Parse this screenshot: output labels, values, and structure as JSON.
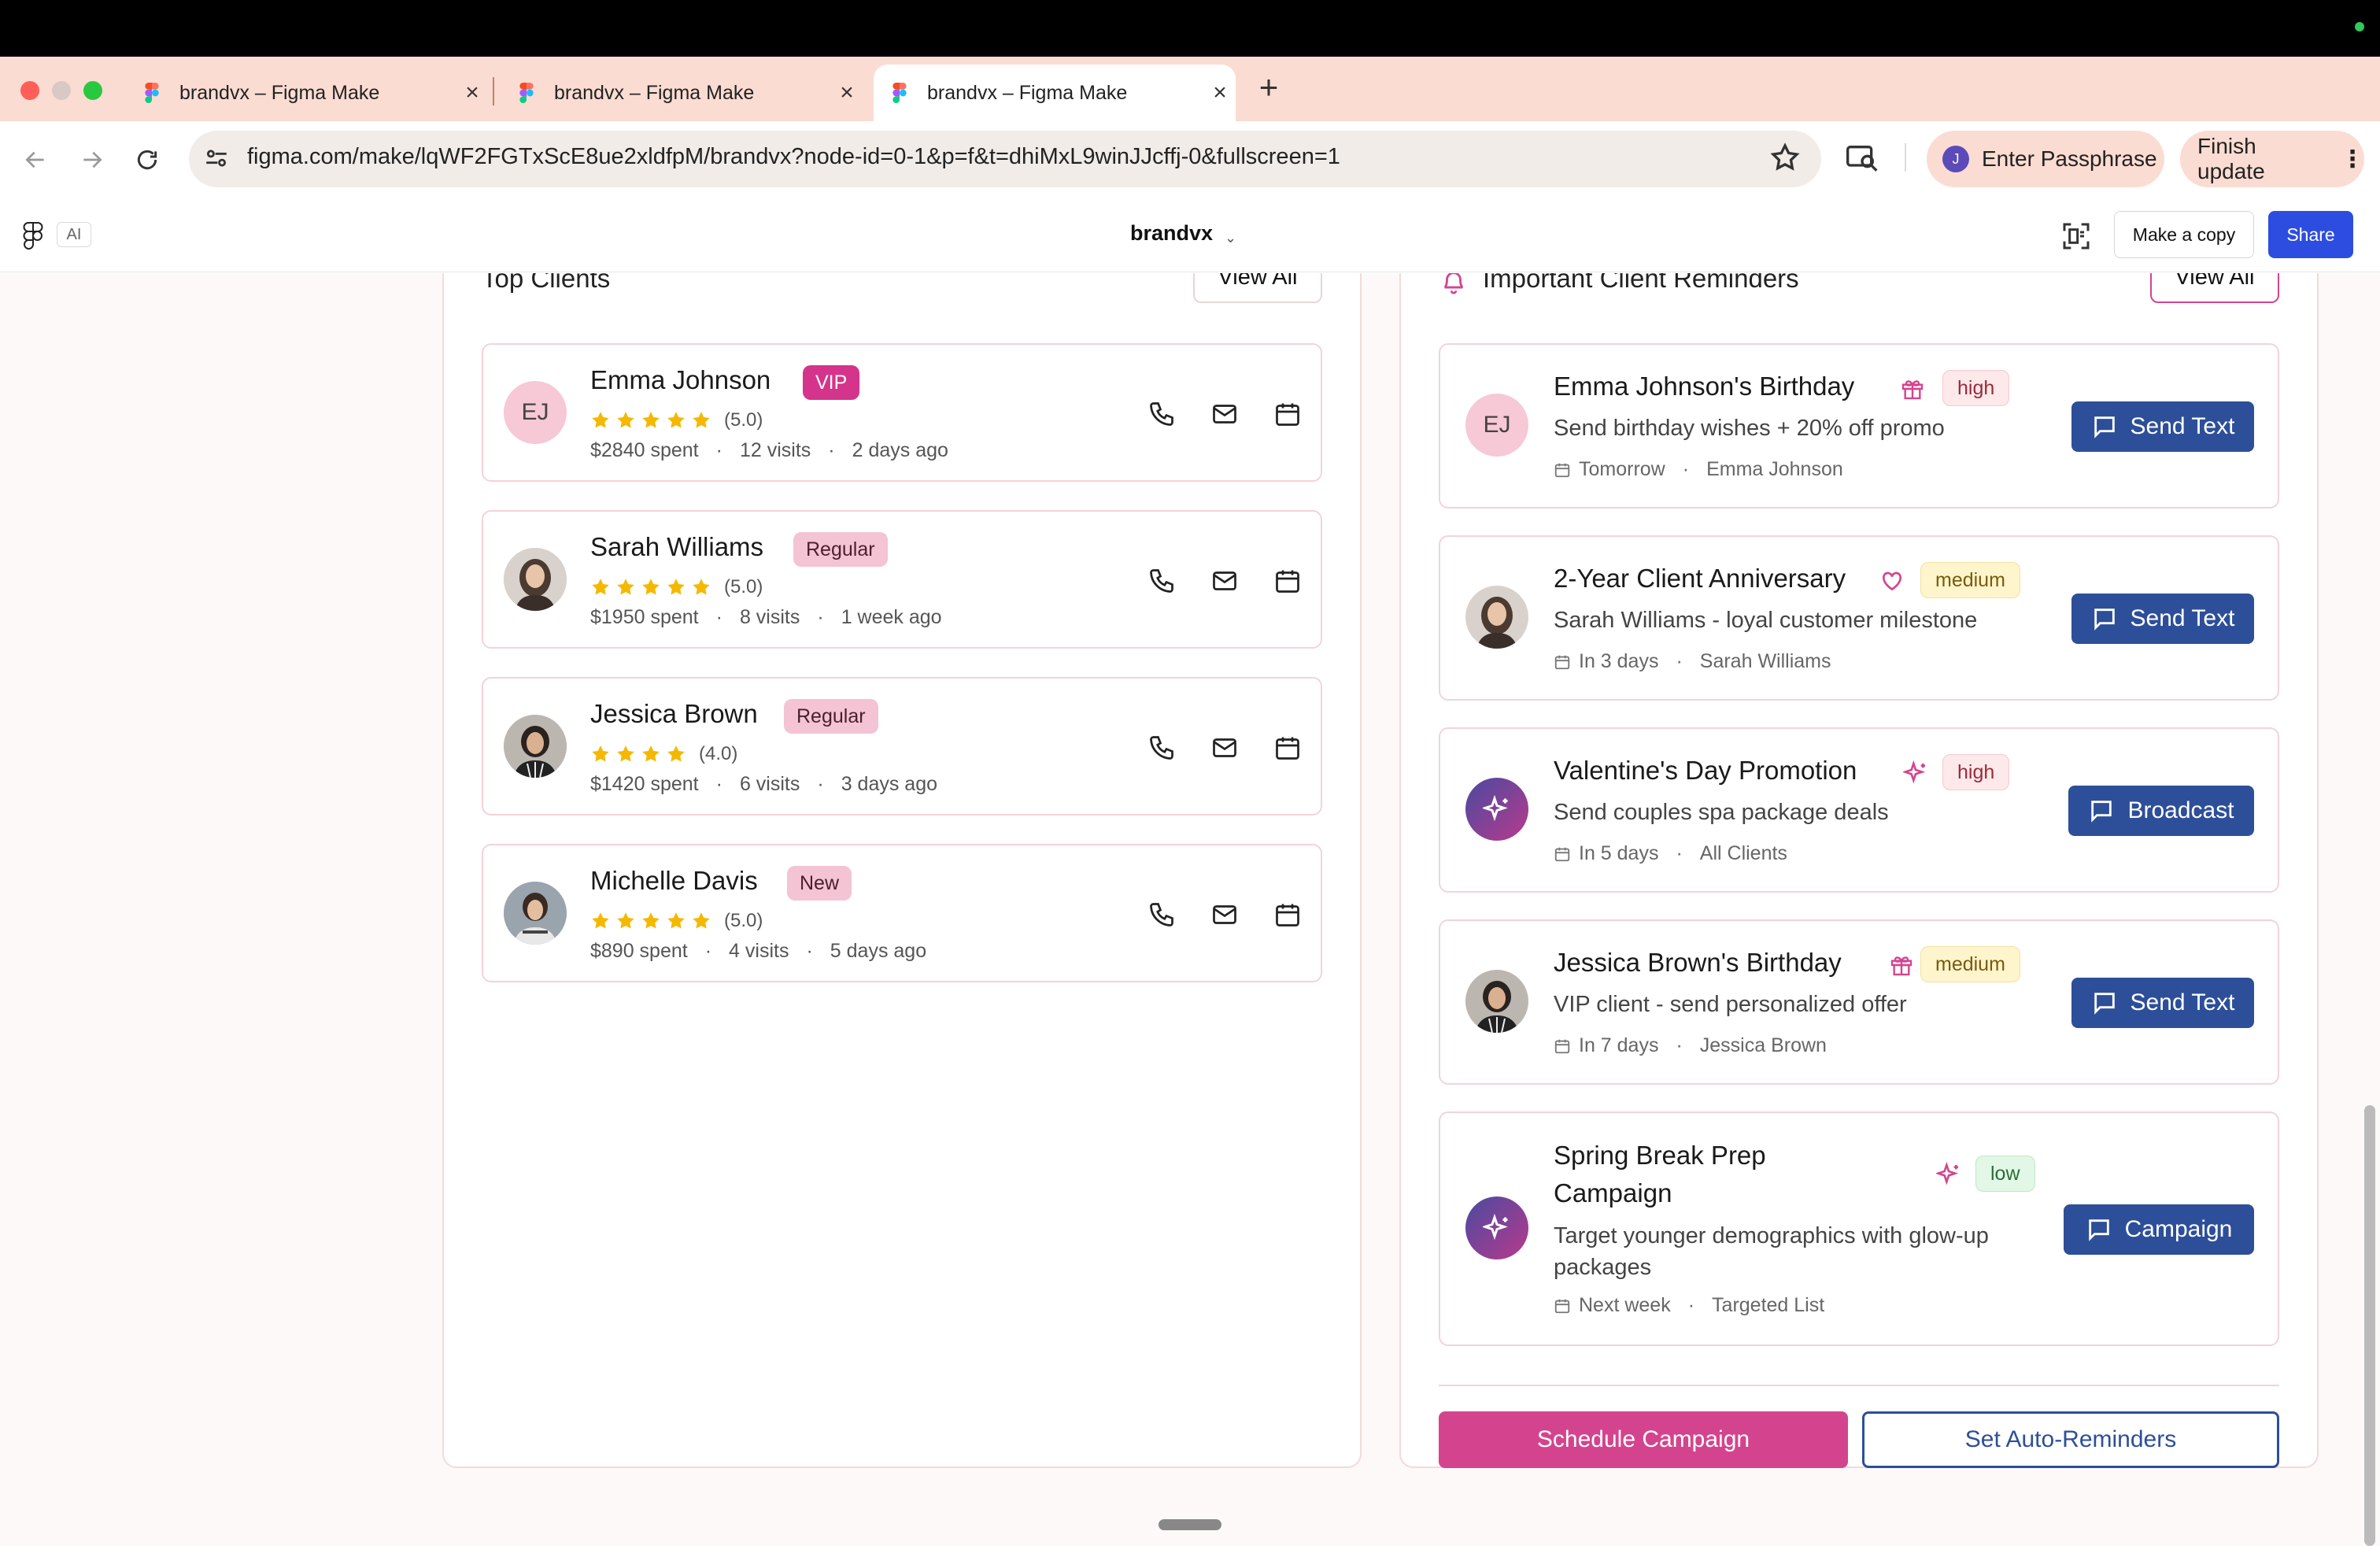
{
  "browser": {
    "tabs": [
      {
        "title": "brandvx – Figma Make",
        "active": false
      },
      {
        "title": "brandvx – Figma Make",
        "active": false
      },
      {
        "title": "brandvx – Figma Make",
        "active": true
      }
    ],
    "url": "figma.com/make/lqWF2FGTxScE8ue2xldfpM/brandvx?node-id=0-1&p=f&t=dhiMxL9winJJcffj-0&fullscreen=1",
    "passphrase_label": "Enter Passphrase",
    "passphrase_avatar": "J",
    "update_label": "Finish update"
  },
  "figma": {
    "ai_badge": "AI",
    "file_name": "brandvx",
    "make_copy_label": "Make a copy",
    "share_label": "Share"
  },
  "top_clients": {
    "title": "Top Clients",
    "view_all": "View All",
    "clients": [
      {
        "name": "Emma Johnson",
        "badge": "VIP",
        "badge_type": "vip",
        "initials": "EJ",
        "stars": 5,
        "rating": "(5.0)",
        "spent": "$2840 spent",
        "visits": "12 visits",
        "last": "2 days ago"
      },
      {
        "name": "Sarah Williams",
        "badge": "Regular",
        "badge_type": "regular",
        "initials": "",
        "stars": 5,
        "rating": "(5.0)",
        "spent": "$1950 spent",
        "visits": "8 visits",
        "last": "1 week ago"
      },
      {
        "name": "Jessica Brown",
        "badge": "Regular",
        "badge_type": "regular",
        "initials": "",
        "stars": 4,
        "rating": "(4.0)",
        "spent": "$1420 spent",
        "visits": "6 visits",
        "last": "3 days ago"
      },
      {
        "name": "Michelle Davis",
        "badge": "New",
        "badge_type": "new",
        "initials": "",
        "stars": 5,
        "rating": "(5.0)",
        "spent": "$890 spent",
        "visits": "4 visits",
        "last": "5 days ago"
      }
    ]
  },
  "reminders": {
    "title": "Important Client Reminders",
    "view_all": "View All",
    "items": [
      {
        "title": "Emma Johnson's Birthday",
        "icon": "gift-icon",
        "priority": "high",
        "desc": "Send birthday wishes + 20% off promo",
        "when": "Tomorrow",
        "who": "Emma Johnson",
        "action": "Send Text",
        "avatar": "EJ"
      },
      {
        "title": "2-Year Client Anniversary",
        "icon": "heart-icon",
        "priority": "medium",
        "desc": "Sarah Williams - loyal customer milestone",
        "when": "In 3 days",
        "who": "Sarah Williams",
        "action": "Send Text",
        "avatar": ""
      },
      {
        "title": "Valentine's Day Promotion",
        "icon": "sparkles-icon",
        "priority": "high",
        "desc": "Send couples spa package deals",
        "when": "In 5 days",
        "who": "All Clients",
        "action": "Broadcast",
        "avatar": ""
      },
      {
        "title": "Jessica Brown's Birthday",
        "icon": "gift-icon",
        "priority": "medium",
        "desc": "VIP client - send personalized offer",
        "when": "In 7 days",
        "who": "Jessica Brown",
        "action": "Send Text",
        "avatar": ""
      },
      {
        "title": "Spring Break Prep Campaign",
        "icon": "sparkles-icon",
        "priority": "low",
        "desc": "Target younger demographics with glow-up packages",
        "when": "Next week",
        "who": "Targeted List",
        "action": "Campaign",
        "avatar": ""
      }
    ],
    "schedule_label": "Schedule Campaign",
    "auto_label": "Set Auto-Reminders"
  },
  "colors": {
    "brand_pink": "#d4448e",
    "brand_blue": "#2d4f99",
    "star": "#f5b800",
    "tab_strip": "#fbdcd2"
  }
}
